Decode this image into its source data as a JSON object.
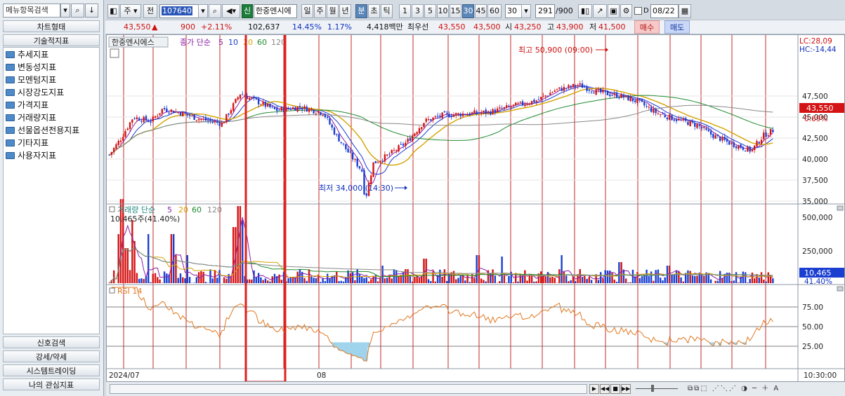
{
  "left_panel": {
    "search_text": "메뉴항목검색",
    "chart_type_btn": "차트형태",
    "tech_indicator_btn": "기술적지표",
    "tree_items": [
      "추세지표",
      "변동성지표",
      "모멘텀지표",
      "시장강도지표",
      "가격지표",
      "거래량지표",
      "선물옵션전용지표",
      "기타지표",
      "사용자지표"
    ],
    "bottom_buttons": [
      "신호검색",
      "강세/약세",
      "시스템트레이딩",
      "나의 관심지표"
    ]
  },
  "toolbar": {
    "period_label": "주",
    "prev_label": "전",
    "code": "107640",
    "new_badge": "신",
    "stock_name": "한중엔시에",
    "periods": [
      "일",
      "주",
      "월",
      "년",
      "분",
      "초",
      "틱"
    ],
    "active_period": "분",
    "intervals": [
      "1",
      "3",
      "5",
      "10",
      "15",
      "30",
      "45",
      "60"
    ],
    "active_interval": "30",
    "interval_select": "30",
    "count": "291",
    "count_total": "/900",
    "date": "08/22",
    "date_prefix": "D"
  },
  "info": {
    "price": "43,550",
    "arrow": "▲",
    "change": "900",
    "change_pct": "+2.11%",
    "volume": "102,637",
    "turnover_pct": "14.45%",
    "ratio_pct": "1.17%",
    "amount": "4,418백만",
    "best_bid_label": "최우선",
    "ask": "43,550",
    "bid": "43,500",
    "open_label": "시",
    "open": "43,250",
    "high_label": "고",
    "high": "43,900",
    "low_label": "저",
    "low": "41,500",
    "buy_btn": "매수",
    "sell_btn": "매도"
  },
  "price_panel": {
    "stock_name": "한중엔시에스",
    "ma_label": "종가 단순",
    "ma_periods": [
      "5",
      "10",
      "20",
      "60",
      "120"
    ],
    "lc": "LC:28,09",
    "hc": "HC:-14,44",
    "high_annot": "최고 50,900 (09:00)",
    "low_annot": "최저 34,000 (14:30)",
    "current_price": "43,550",
    "current_pct": "0.69%",
    "y_ticks": [
      "47,500",
      "45,000",
      "42,500",
      "40,000",
      "37,500",
      "35,000"
    ]
  },
  "volume_panel": {
    "label": "거래량 단순",
    "ma_periods": [
      "5",
      "20",
      "60",
      "120"
    ],
    "value_text": "10,465주(41.40%)",
    "current": "10,465",
    "current_pct": "41.40%",
    "y_ticks": [
      "500,000",
      "250,000"
    ]
  },
  "rsi_panel": {
    "label": "RSI 14",
    "y_ticks": [
      "75.00",
      "50.00",
      "25.00"
    ]
  },
  "x_axis": {
    "labels": [
      "2024/07",
      "08"
    ],
    "time": "10:30:00"
  },
  "colors": {
    "up": "#d41414",
    "down": "#1a3fd0",
    "ma5": "#8a1fa8",
    "ma10": "#1a3fd0",
    "ma20": "#d4a300",
    "ma60": "#208a30",
    "ma120": "#888888",
    "rsi": "#e07820",
    "highlight": "#e02020"
  }
}
